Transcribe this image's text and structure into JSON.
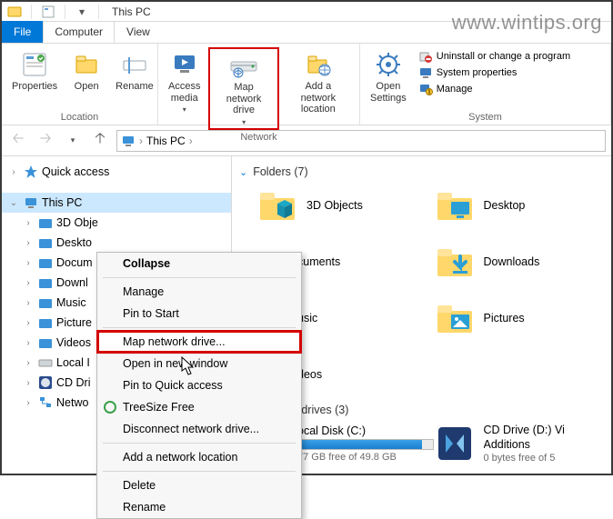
{
  "watermark": "www.wintips.org",
  "titlebar": {
    "title": "This PC"
  },
  "tabs": {
    "file": "File",
    "computer": "Computer",
    "view": "View"
  },
  "ribbon": {
    "location": {
      "properties": "Properties",
      "open": "Open",
      "rename": "Rename",
      "group_label": "Location"
    },
    "network": {
      "access_media": "Access\nmedia",
      "map_network_drive": "Map network\ndrive",
      "add_network_location": "Add a network\nlocation",
      "group_label": "Network"
    },
    "system": {
      "open_settings": "Open\nSettings",
      "uninstall": "Uninstall or change a program",
      "sys_props": "System properties",
      "manage": "Manage",
      "group_label": "System"
    }
  },
  "addr": {
    "location": "This PC"
  },
  "tree": {
    "quick_access": "Quick access",
    "this_pc": "This PC",
    "children": [
      "3D Obje",
      "Deskto",
      "Docum",
      "Downl",
      "Music",
      "Picture",
      "Videos",
      "Local I",
      "CD Dri",
      "Netwo"
    ]
  },
  "context_menu": {
    "collapse": "Collapse",
    "manage": "Manage",
    "pin_start": "Pin to Start",
    "map": "Map network drive...",
    "open_new": "Open in new window",
    "pin_quick": "Pin to Quick access",
    "treesize": "TreeSize Free",
    "disconnect": "Disconnect network drive...",
    "add_loc": "Add a network location",
    "delete": "Delete",
    "rename": "Rename"
  },
  "content": {
    "folders_header": "Folders (7)",
    "folders": [
      {
        "label": "3D Objects"
      },
      {
        "label": "Desktop"
      },
      {
        "label": "cuments"
      },
      {
        "label": "Downloads"
      },
      {
        "label": "usic"
      },
      {
        "label": "Pictures"
      },
      {
        "label": "deos"
      }
    ],
    "drives_header": "and drives (3)",
    "drives": [
      {
        "label": "ocal Disk (C:)",
        "sub": "77 GB free of 49.8 GB",
        "fill_pct": 92
      },
      {
        "label": "CD Drive (D:) Vi",
        "sub1": "Additions",
        "sub2": "0 bytes free of 5"
      }
    ]
  }
}
